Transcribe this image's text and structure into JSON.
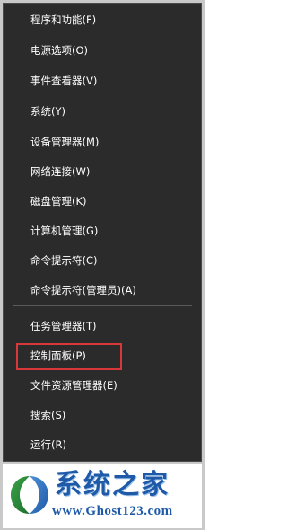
{
  "menu": {
    "items": [
      {
        "label": "程序和功能(F)"
      },
      {
        "label": "电源选项(O)"
      },
      {
        "label": "事件查看器(V)"
      },
      {
        "label": "系统(Y)"
      },
      {
        "label": "设备管理器(M)"
      },
      {
        "label": "网络连接(W)"
      },
      {
        "label": "磁盘管理(K)"
      },
      {
        "label": "计算机管理(G)"
      },
      {
        "label": "命令提示符(C)"
      },
      {
        "label": "命令提示符(管理员)(A)"
      },
      {
        "label": "任务管理器(T)"
      },
      {
        "label": "控制面板(P)"
      },
      {
        "label": "文件资源管理器(E)"
      },
      {
        "label": "搜索(S)"
      },
      {
        "label": "运行(R)"
      }
    ],
    "highlighted_item": "控制面板(P)",
    "highlight_color": "#d9383a",
    "background_color": "#2b2b2b"
  },
  "watermark": {
    "title": "系统之家",
    "url": "www.Ghost123.com",
    "brand_color": "#1e5aa8"
  }
}
